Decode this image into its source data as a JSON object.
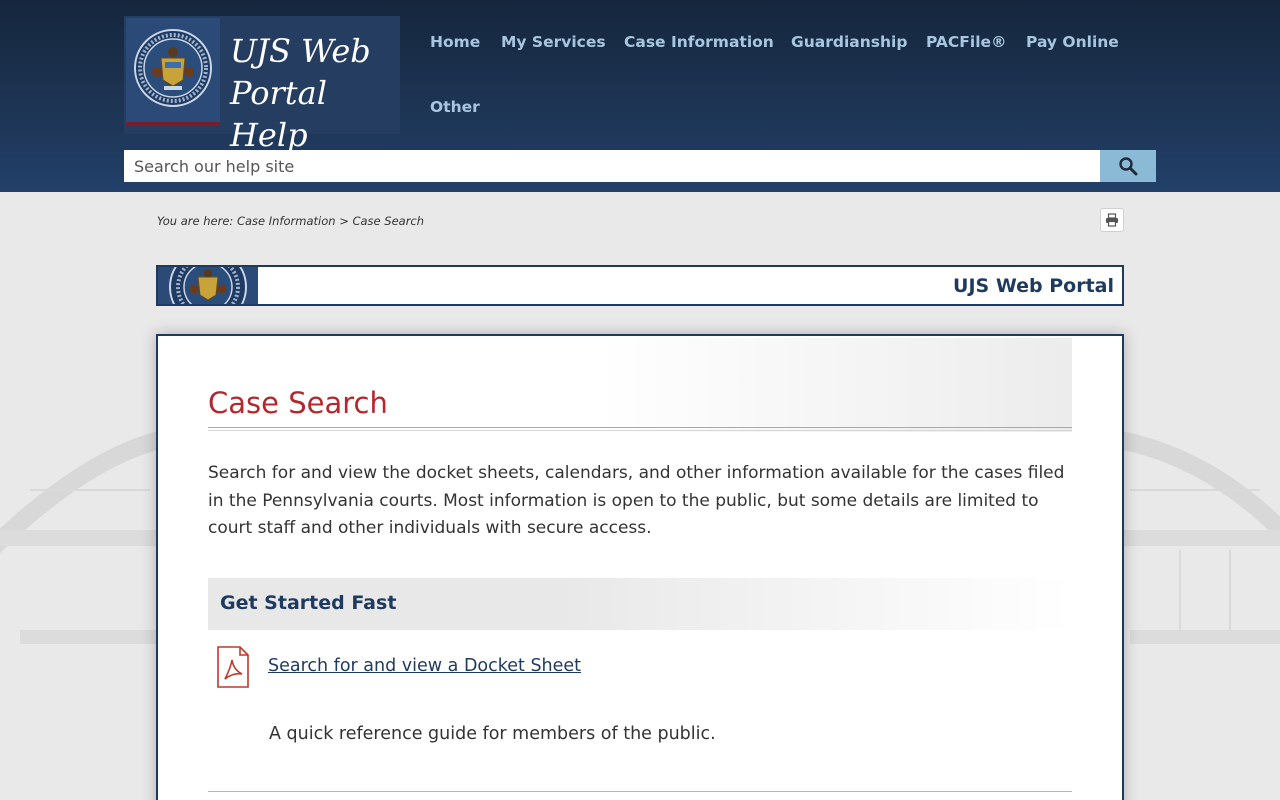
{
  "header": {
    "logo_title_line1": "UJS Web",
    "logo_title_line2": "Portal Help",
    "nav": [
      {
        "label": "Home"
      },
      {
        "label": "My Services"
      },
      {
        "label": "Case Information"
      },
      {
        "label": "Guardianship"
      },
      {
        "label": "PACFile®"
      },
      {
        "label": "Pay Online"
      },
      {
        "label": "Other"
      }
    ],
    "search": {
      "placeholder": "Search our help site"
    }
  },
  "breadcrumb": {
    "prefix": "You are here:",
    "parent": "Case Information",
    "separator": ">",
    "current": "Case Search"
  },
  "banner": {
    "title": "UJS Web Portal"
  },
  "main": {
    "title": "Case Search",
    "intro": "Search for and view the docket sheets, calendars, and other information available for the cases filed in the Pennsylvania courts. Most information is open to the public, but some details are limited to court staff and other individuals with secure access.",
    "section_title": "Get Started Fast",
    "link_label": "Search for and view a Docket Sheet",
    "link_desc": "A quick reference guide for members of the public."
  },
  "colors": {
    "header_bg": "#1d3453",
    "nav_text": "#a8c6e0",
    "title_red": "#b3272e",
    "navy": "#1f3a5f",
    "search_button": "#8bbad6"
  },
  "icons": [
    "seal-emblem",
    "search-icon",
    "print-icon",
    "pdf-file-icon"
  ]
}
